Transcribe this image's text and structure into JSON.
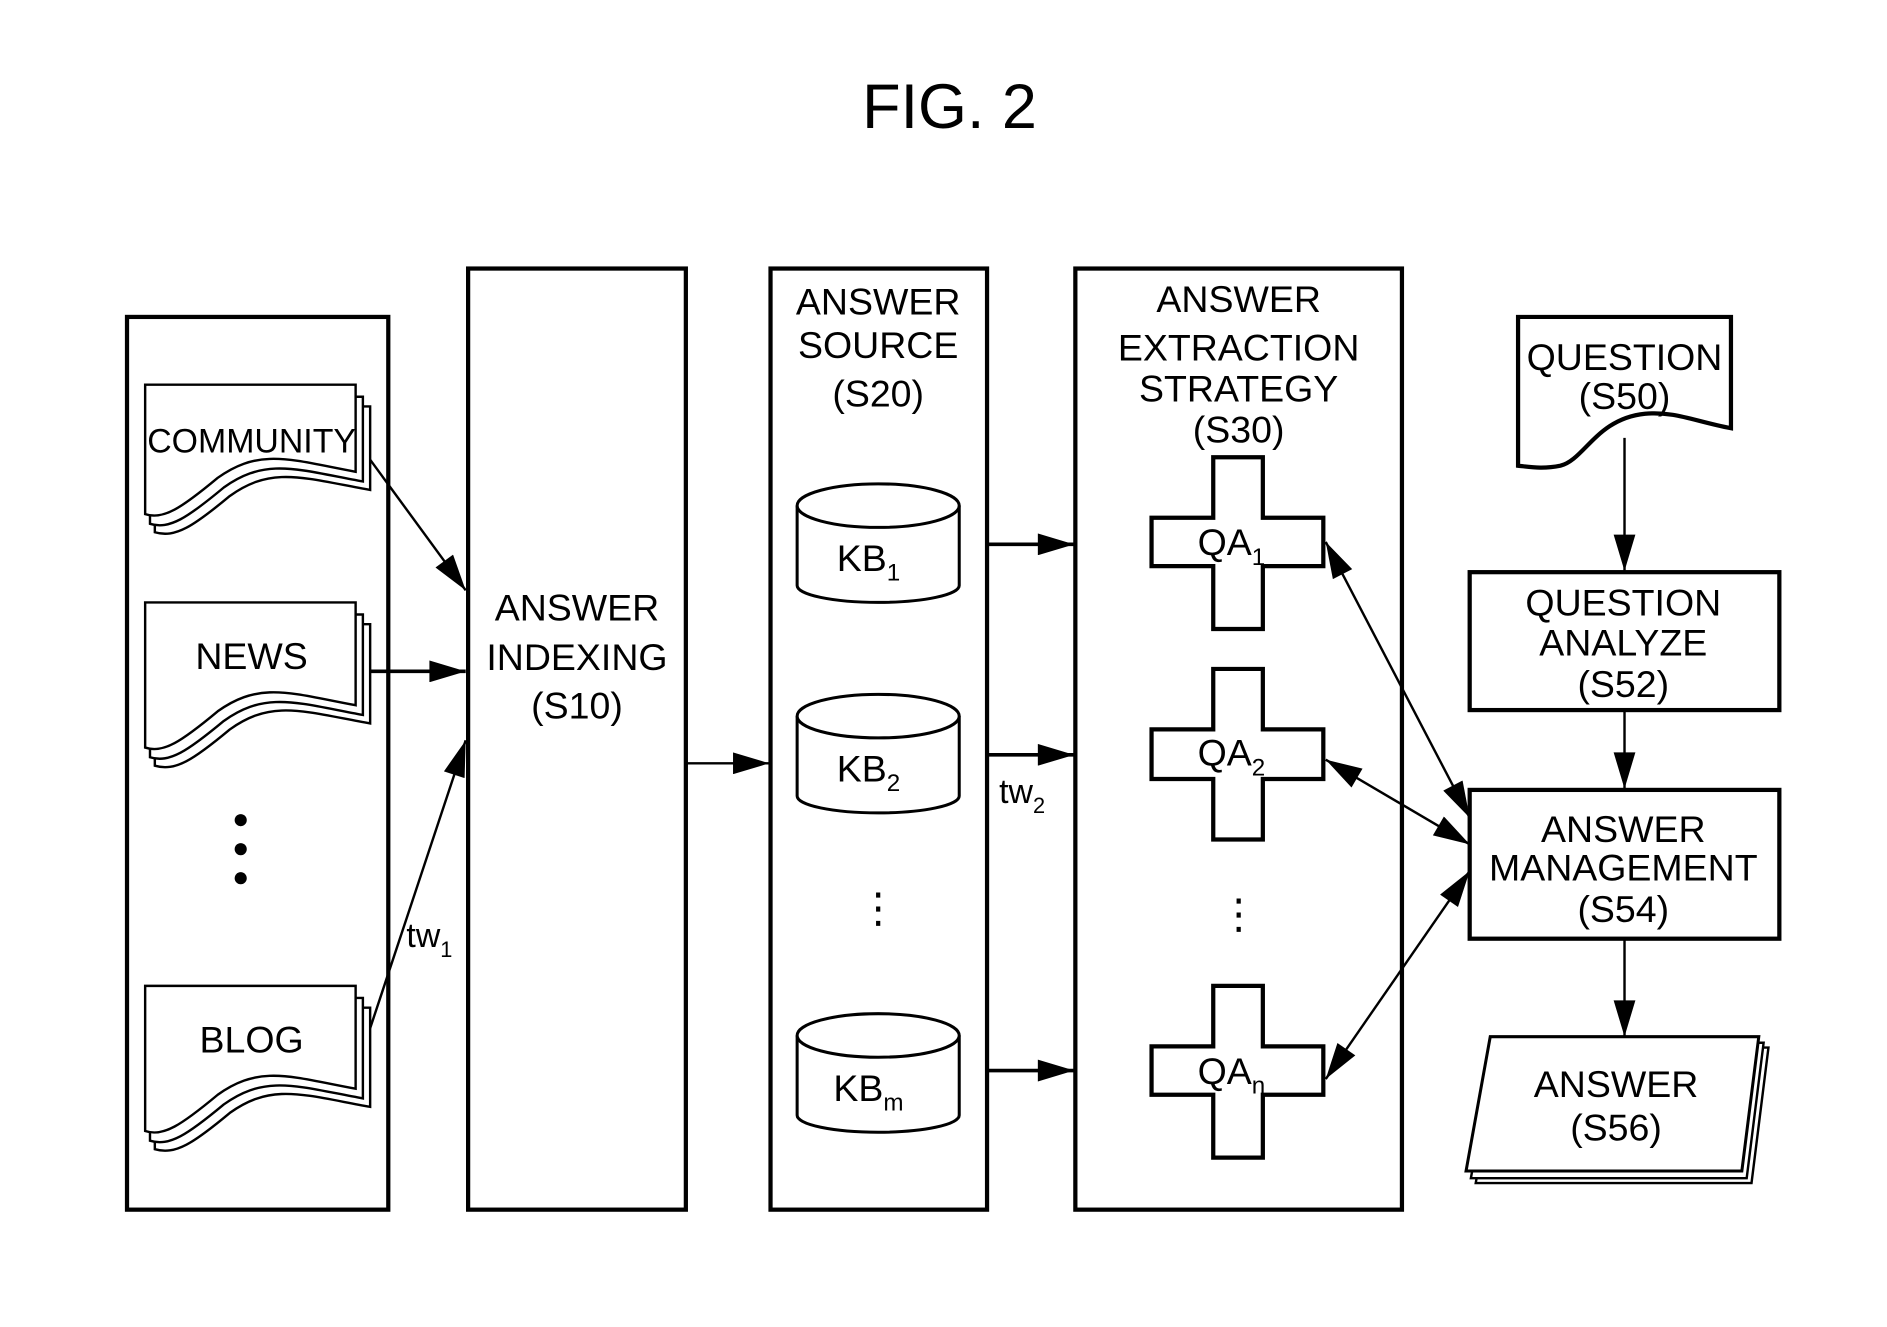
{
  "figure": {
    "title": "FIG. 2"
  },
  "sources": {
    "items": [
      {
        "label": "COMMUNITY"
      },
      {
        "label": "NEWS"
      },
      {
        "label": "BLOG"
      }
    ],
    "weight_label": {
      "main": "tw",
      "sub": "1"
    }
  },
  "indexing": {
    "lines": [
      "ANSWER",
      "INDEXING",
      "(S10)"
    ]
  },
  "answer_source": {
    "lines": [
      "ANSWER",
      "SOURCE",
      "(S20)"
    ],
    "kbs": [
      {
        "main": "KB",
        "sub": "1"
      },
      {
        "main": "KB",
        "sub": "2"
      },
      {
        "main": "KB",
        "sub": "m"
      }
    ],
    "weight_label": {
      "main": "tw",
      "sub": "2"
    }
  },
  "extraction": {
    "lines": [
      "ANSWER",
      "EXTRACTION",
      "STRATEGY",
      "(S30)"
    ],
    "qas": [
      {
        "main": "QA",
        "sub": "1"
      },
      {
        "main": "QA",
        "sub": "2"
      },
      {
        "main": "QA",
        "sub": "n"
      }
    ]
  },
  "question": {
    "lines": [
      "QUESTION",
      "(S50)"
    ]
  },
  "question_analyze": {
    "lines": [
      "QUESTION",
      "ANALYZE",
      "(S52)"
    ]
  },
  "answer_management": {
    "lines": [
      "ANSWER",
      "MANAGEMENT",
      "(S54)"
    ]
  },
  "answer": {
    "lines": [
      "ANSWER",
      "(S56)"
    ]
  },
  "ellipsis": "⋮"
}
